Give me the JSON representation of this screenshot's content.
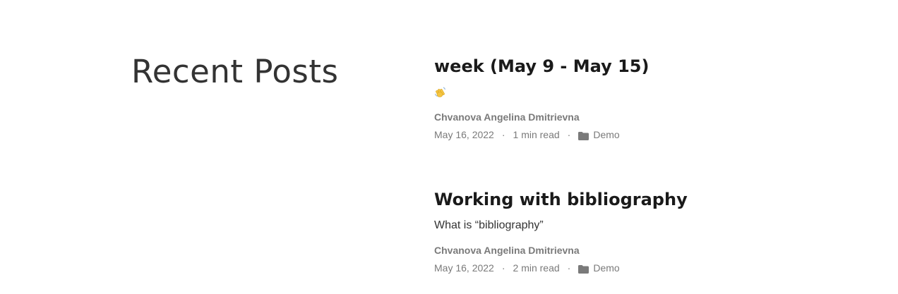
{
  "section": {
    "title": "Recent Posts"
  },
  "posts": [
    {
      "title": "week (May 9 - May 15)",
      "summary_icon": "waving-hand-icon",
      "summary": "",
      "author": "Chvanova Angelina Dmitrievna",
      "date": "May 16, 2022",
      "separator": "·",
      "read_time": "1 min read",
      "category_icon": "folder-icon",
      "category": "Demo"
    },
    {
      "title": "Working with bibliography",
      "summary": "What is “bibliography”",
      "author": "Chvanova Angelina Dmitrievna",
      "date": "May 16, 2022",
      "separator": "·",
      "read_time": "2 min read",
      "category_icon": "folder-icon",
      "category": "Demo"
    }
  ],
  "colors": {
    "title": "#1a1a1a",
    "heading": "#333333",
    "meta": "#7a7a7a",
    "wave_icon": "#f5c542"
  }
}
